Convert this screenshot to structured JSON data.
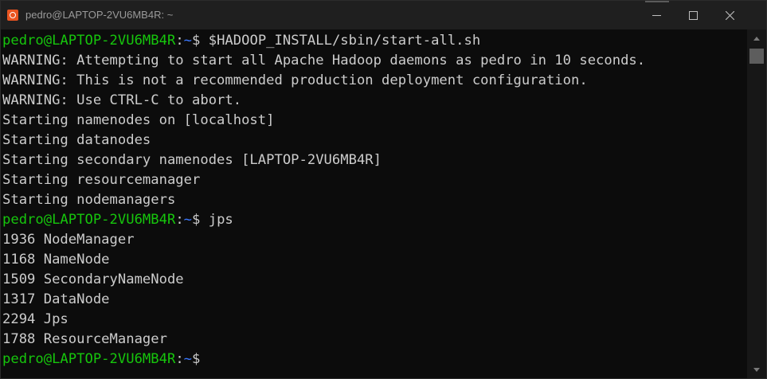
{
  "window": {
    "title": "pedro@LAPTOP-2VU6MB4R: ~",
    "icon": "ubuntu-icon"
  },
  "terminal": {
    "colors": {
      "background": "#0c0c0c",
      "foreground": "#cccccc",
      "user": "#16c60c",
      "path": "#3b78ff"
    },
    "prompts": [
      {
        "user": "pedro@LAPTOP-2VU6MB4R",
        "sep": ":",
        "path": "~",
        "symbol": "$ ",
        "command": "$HADOOP_INSTALL/sbin/start-all.sh"
      },
      {
        "user": "pedro@LAPTOP-2VU6MB4R",
        "sep": ":",
        "path": "~",
        "symbol": "$ ",
        "command": "jps"
      },
      {
        "user": "pedro@LAPTOP-2VU6MB4R",
        "sep": ":",
        "path": "~",
        "symbol": "$",
        "command": ""
      }
    ],
    "output1": [
      "WARNING: Attempting to start all Apache Hadoop daemons as pedro in 10 seconds.",
      "WARNING: This is not a recommended production deployment configuration.",
      "WARNING: Use CTRL-C to abort.",
      "Starting namenodes on [localhost]",
      "Starting datanodes",
      "Starting secondary namenodes [LAPTOP-2VU6MB4R]",
      "Starting resourcemanager",
      "Starting nodemanagers"
    ],
    "output2": [
      "1936 NodeManager",
      "1168 NameNode",
      "1509 SecondaryNameNode",
      "1317 DataNode",
      "2294 Jps",
      "1788 ResourceManager"
    ]
  }
}
